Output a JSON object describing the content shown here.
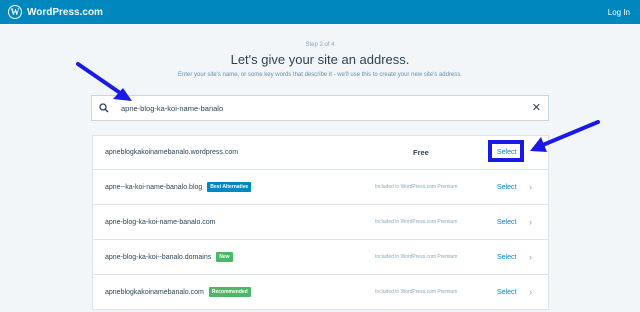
{
  "topbar": {
    "brand": "WordPress.com",
    "logo_letter": "W",
    "login": "Log In"
  },
  "header": {
    "step": "Step 2 of 4",
    "title": "Let's give your site an address.",
    "subtitle": "Enter your site's name, or some key words that describe it - we'll use this to create your new site's address."
  },
  "search": {
    "value": "apne-blog-ka-koi-name-banalo",
    "clear": "✕"
  },
  "results": [
    {
      "domain": "apneblogkakoinamebanalo.wordpress.com",
      "badge": "",
      "price": "Free",
      "select": "Select"
    },
    {
      "domain": "apne--ka-koi-name-banalo.blog",
      "badge": "Best Alternative",
      "price": "Included in WordPress.com Premium",
      "select": "Select"
    },
    {
      "domain": "apne-blog-ka-koi-name-banalo.com",
      "badge": "",
      "price": "Included in WordPress.com Premium",
      "select": "Select"
    },
    {
      "domain": "apne-blog-ka-koi--banalo.domains",
      "badge": "New",
      "price": "Included in WordPress.com Premium",
      "select": "Select"
    },
    {
      "domain": "apneblogkakoinamebanalo.com",
      "badge": "Recommended",
      "price": "Included in WordPress.com Premium",
      "select": "Select"
    }
  ],
  "colors": {
    "topbar": "#0087be",
    "accent": "#0087be",
    "annotation": "#1a1ae6",
    "badge_new": "#4ab866"
  }
}
